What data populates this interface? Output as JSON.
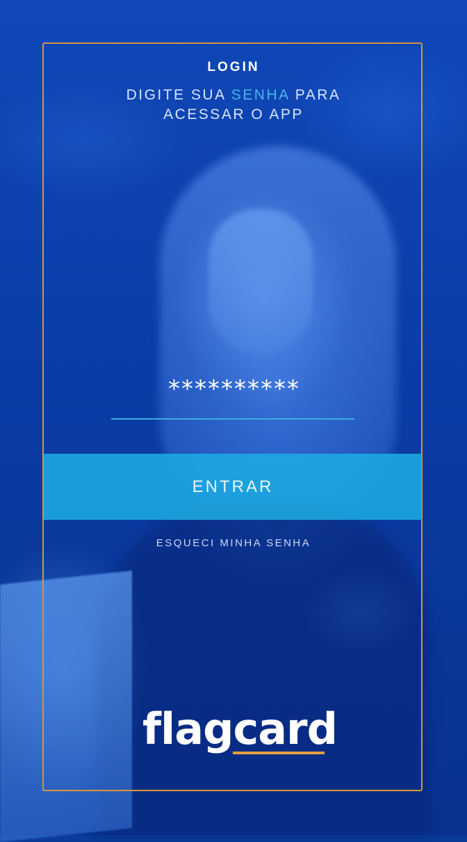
{
  "login": {
    "title": "LOGIN",
    "subtitle_line1_pre": "DIGITE SUA ",
    "subtitle_highlight": "SENHA",
    "subtitle_line1_post": " PARA",
    "subtitle_line2": "ACESSAR O APP"
  },
  "password": {
    "value": "**********"
  },
  "enter_button": {
    "label": "ENTRAR"
  },
  "forgot_link": {
    "label": "ESQUECI MINHA SENHA"
  },
  "brand": {
    "name": "flagcard"
  },
  "colors": {
    "background": "#0b3ca6",
    "frame": "#d8953a",
    "accent": "#1caae1",
    "highlight": "#47b8e8"
  }
}
